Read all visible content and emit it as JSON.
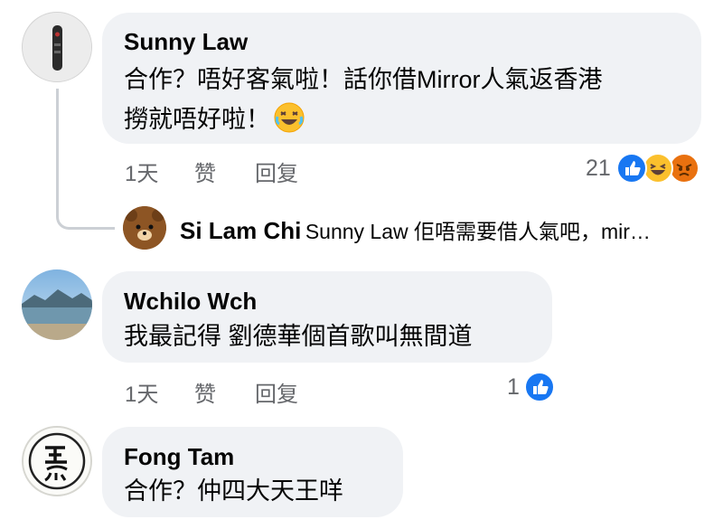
{
  "comments": [
    {
      "author": "Sunny Law",
      "line1": "合作？唔好客氣啦！話你借Mirror人氣返香港",
      "line2": "撈就唔好啦！",
      "actions": {
        "time": "1天",
        "like": "赞",
        "reply": "回复"
      },
      "reaction_count": "21",
      "reactions": [
        "like-icon",
        "haha-icon",
        "angry-icon"
      ]
    },
    {
      "author": "Wchilo Wch",
      "line1": "我最記得 劉德華個首歌叫無間道",
      "actions": {
        "time": "1天",
        "like": "赞",
        "reply": "回复"
      },
      "reaction_count": "1",
      "reactions": [
        "like-icon"
      ]
    },
    {
      "author": "Fong Tam",
      "line1": "合作？仲四大天王咩"
    }
  ],
  "reply_preview": {
    "author": "Si Lam Chi",
    "text": "Sunny Law 佢唔需要借人氣吧，mir…"
  },
  "colors": {
    "bubble": "#f0f2f5",
    "secondary_text": "#65676b",
    "like_blue": "#1877f2",
    "angry_red": "#e9710f"
  }
}
